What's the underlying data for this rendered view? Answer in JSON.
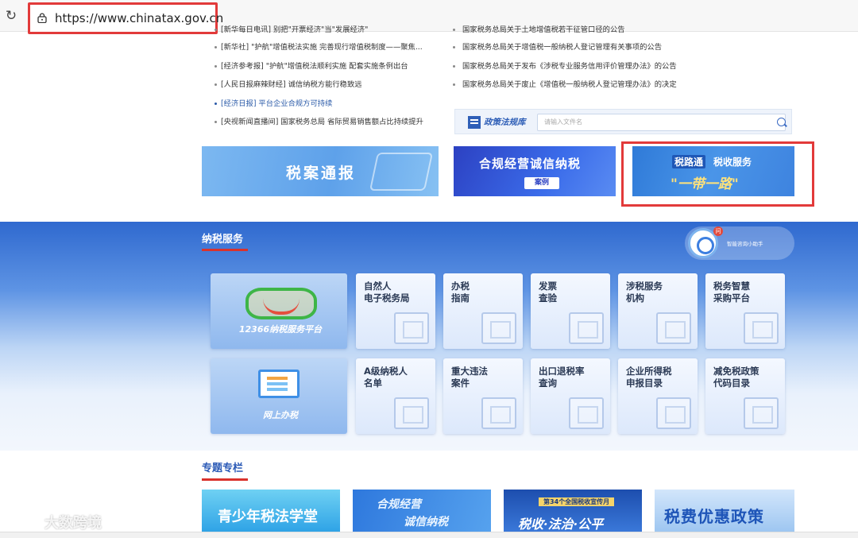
{
  "browser": {
    "url": "https://www.chinatax.gov.cn"
  },
  "news_left": [
    "[新华每日电讯] 别把\"开票经济\"当\"发展经济\"",
    "[新华社] \"护航\"增值税法实施 完善现行增值税制度——聚焦...",
    "[经济参考报] \"护航\"增值税法顺利实施 配套实施条例出台",
    "[人民日报麻辣财经] 诚信纳税方能行稳致远",
    "[经济日报] 平台企业合规方可持续",
    "[央视新闻直播间] 国家税务总局 省际贸易销售额占比持续提升"
  ],
  "news_right": [
    "国家税务总局关于土地增值税若干征管口径的公告",
    "国家税务总局关于增值税一般纳税人登记管理有关事项的公告",
    "国家税务总局关于发布《涉税专业服务信用评价管理办法》的公告",
    "国家税务总局关于废止《增值税一般纳税人登记管理办法》的决定"
  ],
  "policy": {
    "title": "政策法规库",
    "placeholder": "请输入文件名"
  },
  "banners": {
    "b1": "税案通报",
    "b2_title": "合规经营诚信纳税",
    "b2_tag": "案例",
    "b3_tag1": "税路通",
    "b3_tag2": "税收服务",
    "b3_title": "\"一带一路\""
  },
  "service": {
    "title": "纳税服务",
    "assistant_badge": "问",
    "assistant_label": "智能咨询小助手",
    "platform_12366": "12366纳税服务平台",
    "online_tax": "网上办税",
    "cards": [
      "自然人 电子税务局",
      "办税 指南",
      "发票 查验",
      "涉税服务 机构",
      "税务智慧 采购平台",
      "A级纳税人 名单",
      "重大违法 案件",
      "出口退税率 查询",
      "企业所得税 申报目录",
      "减免税政策 代码目录"
    ]
  },
  "topics": {
    "title": "专题专栏",
    "t1": "青少年税法学堂",
    "t2a": "合规经营",
    "t2b": "诚信纳税",
    "t3a": "第34个全国税收宣传月",
    "t3b": "税收·法治·公平",
    "t4": "税费优惠政策"
  },
  "watermark": "大数跨境"
}
